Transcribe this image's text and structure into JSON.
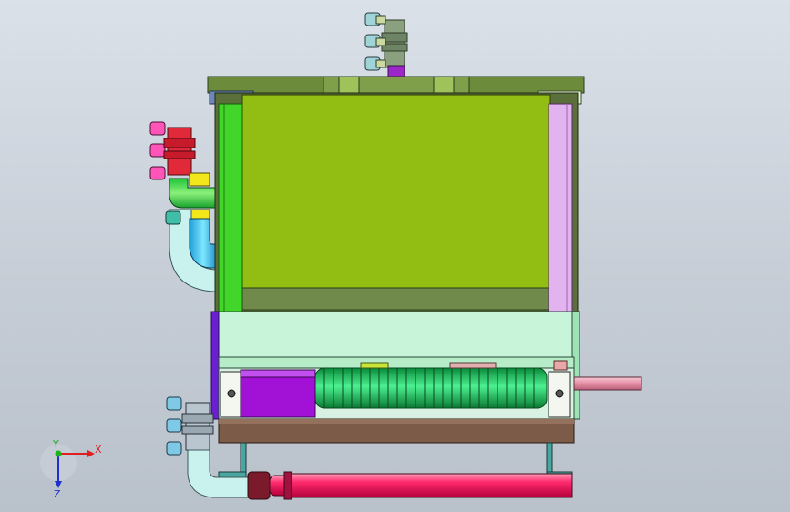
{
  "triad": {
    "x_label": "X",
    "y_label": "Y",
    "z_label": "Z",
    "x_color": "#e02020",
    "y_color": "#20b020",
    "z_color": "#2030d0"
  },
  "colors": {
    "top_plate": "#6c8c3c",
    "tank_fill": "#92be13",
    "tank_bottom": "#6f8a4b",
    "left_post": "#42d62a",
    "right_post": "#e2b3ee",
    "mint_housing": "#c8f5d9",
    "base_plate": "#7d5b49",
    "roller": "#2ae07a",
    "motor_block": "#a212d6",
    "red_pipe": "#ee1458",
    "pink_shaft": "#e79aae",
    "cyan_pipe": "#5ad3f0",
    "light_pipe": "#c9f1ee",
    "purple_left_strip": "#6a1fd0"
  },
  "model_parts": [
    "top-plate",
    "tank",
    "left-post",
    "right-post",
    "mint-housing",
    "roller-assembly",
    "motor-block",
    "base-plate",
    "red-pipe",
    "shaft",
    "top-valve",
    "left-upper-valve",
    "left-lower-valve",
    "left-elbow-pipe",
    "lower-elbow-pipe"
  ]
}
